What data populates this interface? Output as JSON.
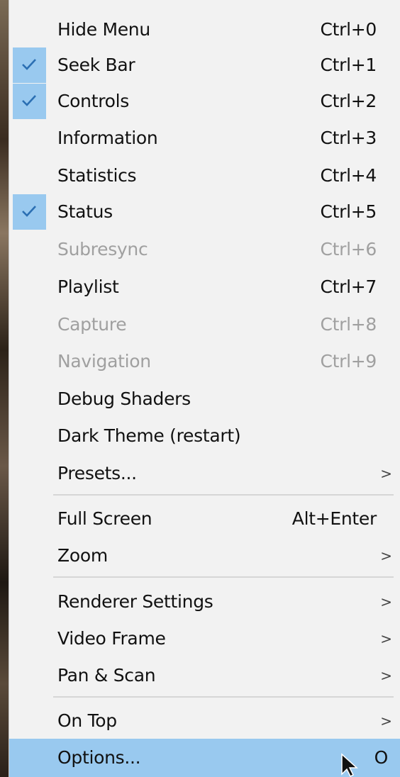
{
  "menu": {
    "items": [
      {
        "label": "Hide Menu",
        "shortcut": "Ctrl+0",
        "checked": false,
        "disabled": false,
        "submenu": false
      },
      {
        "label": "Seek Bar",
        "shortcut": "Ctrl+1",
        "checked": true,
        "disabled": false,
        "submenu": false
      },
      {
        "label": "Controls",
        "shortcut": "Ctrl+2",
        "checked": true,
        "disabled": false,
        "submenu": false
      },
      {
        "label": "Information",
        "shortcut": "Ctrl+3",
        "checked": false,
        "disabled": false,
        "submenu": false
      },
      {
        "label": "Statistics",
        "shortcut": "Ctrl+4",
        "checked": false,
        "disabled": false,
        "submenu": false
      },
      {
        "label": "Status",
        "shortcut": "Ctrl+5",
        "checked": true,
        "disabled": false,
        "submenu": false
      },
      {
        "label": "Subresync",
        "shortcut": "Ctrl+6",
        "checked": false,
        "disabled": true,
        "submenu": false
      },
      {
        "label": "Playlist",
        "shortcut": "Ctrl+7",
        "checked": false,
        "disabled": false,
        "submenu": false
      },
      {
        "label": "Capture",
        "shortcut": "Ctrl+8",
        "checked": false,
        "disabled": true,
        "submenu": false
      },
      {
        "label": "Navigation",
        "shortcut": "Ctrl+9",
        "checked": false,
        "disabled": true,
        "submenu": false
      },
      {
        "label": "Debug Shaders",
        "shortcut": "",
        "checked": false,
        "disabled": false,
        "submenu": false
      },
      {
        "label": "Dark Theme (restart)",
        "shortcut": "",
        "checked": false,
        "disabled": false,
        "submenu": false
      },
      {
        "label": "Presets...",
        "shortcut": "",
        "checked": false,
        "disabled": false,
        "submenu": true
      },
      {
        "label": "Full Screen",
        "shortcut": "Alt+Enter",
        "checked": false,
        "disabled": false,
        "submenu": false
      },
      {
        "label": "Zoom",
        "shortcut": "",
        "checked": false,
        "disabled": false,
        "submenu": true
      },
      {
        "label": "Renderer Settings",
        "shortcut": "",
        "checked": false,
        "disabled": false,
        "submenu": true
      },
      {
        "label": "Video Frame",
        "shortcut": "",
        "checked": false,
        "disabled": false,
        "submenu": true
      },
      {
        "label": "Pan & Scan",
        "shortcut": "",
        "checked": false,
        "disabled": false,
        "submenu": true
      },
      {
        "label": "On Top",
        "shortcut": "",
        "checked": false,
        "disabled": false,
        "submenu": true
      },
      {
        "label": "Options...",
        "shortcut": "O",
        "checked": false,
        "disabled": false,
        "submenu": false,
        "selected": true
      }
    ],
    "submenu_arrow": ">",
    "check_icon": "checkmark-icon"
  },
  "colors": {
    "menu_bg": "#f2f2f2",
    "highlight": "#99c9ef",
    "check": "#2b6fb3",
    "text": "#111111",
    "disabled_text": "#a0a0a0",
    "separator": "#d6d6d6"
  }
}
